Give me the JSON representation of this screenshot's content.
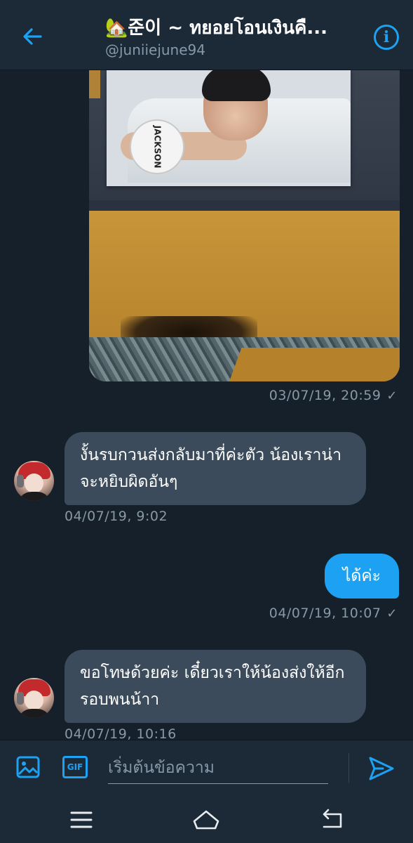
{
  "header": {
    "title": "🏡준이 ~ ทยอยโอนเงินคื...",
    "handle": "@juniiejune94",
    "icons": {
      "back": "arrow-left-icon",
      "info": "info-icon"
    },
    "info_glyph": "i"
  },
  "photo": {
    "badge_text": "JACKSON"
  },
  "messages": [
    {
      "type": "image",
      "time": "03/07/19, 20:59",
      "check": "✓"
    },
    {
      "type": "in",
      "text": "งั้นรบกวนส่งกลับมาที่ค่ะตัว น้องเราน่าจะหยิบผิดอันๆ",
      "time": "04/07/19, 9:02"
    },
    {
      "type": "out",
      "text": "ได้ค่ะ",
      "time": "04/07/19, 10:07",
      "check": "✓"
    },
    {
      "type": "in",
      "text": "ขอโทษด้วยค่ะ เดี๋ยวเราให้น้องส่งให้อีกรอบพนน้าา",
      "time": "04/07/19, 10:16"
    }
  ],
  "composer": {
    "placeholder": "เริ่มต้นข้อความ",
    "gif_label": "GIF",
    "icons": {
      "image": "image-icon",
      "send": "send-icon"
    }
  },
  "navbar": {
    "icons": [
      "menu-icon",
      "home-icon",
      "back-icon"
    ]
  },
  "colors": {
    "background": "#15202b",
    "header": "#1c2a38",
    "accent": "#1da1f2",
    "incoming_bubble": "#3b4b5b",
    "muted_text": "#8899a6"
  }
}
